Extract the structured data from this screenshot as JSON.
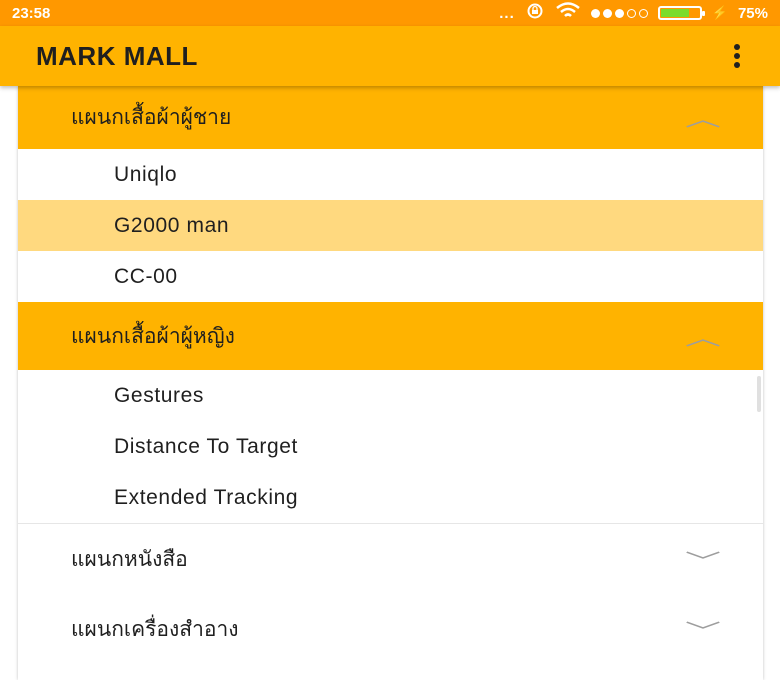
{
  "status_bar": {
    "time": "23:58",
    "more": "...",
    "battery_percent": "75%",
    "battery_level": 0.75,
    "signal_filled": 3,
    "signal_total": 5
  },
  "app_bar": {
    "title": "MARK MALL",
    "menu_icon": "more-vert-icon"
  },
  "groups": [
    {
      "label": "แผนกเสื้อผ้าผู้ชาย",
      "expanded": true,
      "icon": "chevron-up-icon",
      "items": [
        "Uniqlo",
        "G2000 man",
        "CC-00"
      ],
      "selected_index": 1
    },
    {
      "label": "แผนกเสื้อผ้าผู้หญิง",
      "expanded": true,
      "icon": "chevron-up-icon",
      "items": [
        "Gestures",
        "Distance To Target",
        "Extended Tracking"
      ]
    },
    {
      "label": "แผนกหนังสือ",
      "expanded": false,
      "icon": "chevron-down-icon"
    },
    {
      "label": "แผนกเครื่องสำอาง",
      "expanded": false,
      "icon": "chevron-down-icon"
    }
  ],
  "colors": {
    "status_bar": "#ff9800",
    "accent": "#ffb300",
    "selected": "#ffd97f"
  }
}
